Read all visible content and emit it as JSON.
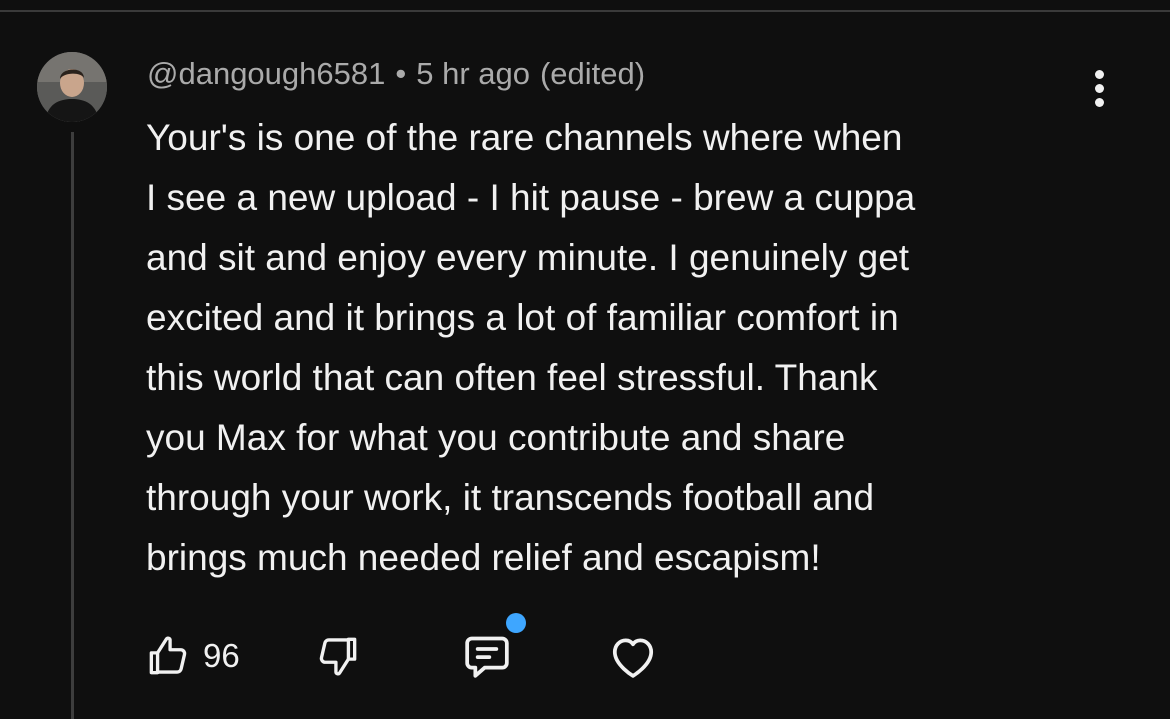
{
  "comment": {
    "author": "@dangough6581",
    "separator": "•",
    "timestamp": "5 hr ago",
    "edited_label": "(edited)",
    "text_lines": [
      "Your's is one of the rare channels where when",
      "I see a new upload - I hit pause - brew a cuppa",
      "and sit and enjoy every minute. I genuinely get",
      "excited and it brings a lot of familiar comfort in",
      "this world that can often feel stressful. Thank",
      "you Max for what you contribute and share",
      "through your work, it transcends football and",
      "brings much needed relief and escapism!"
    ],
    "like_count": "96"
  },
  "icons": {
    "menu": "more-vertical-icon",
    "like": "thumbs-up-icon",
    "dislike": "thumbs-down-icon",
    "reply": "reply-comment-icon",
    "heart": "heart-icon"
  },
  "colors": {
    "background": "#0f0f0f",
    "text": "#f1f1f1",
    "meta_text": "#aaaaaa",
    "notification_dot": "#3ea6ff"
  }
}
